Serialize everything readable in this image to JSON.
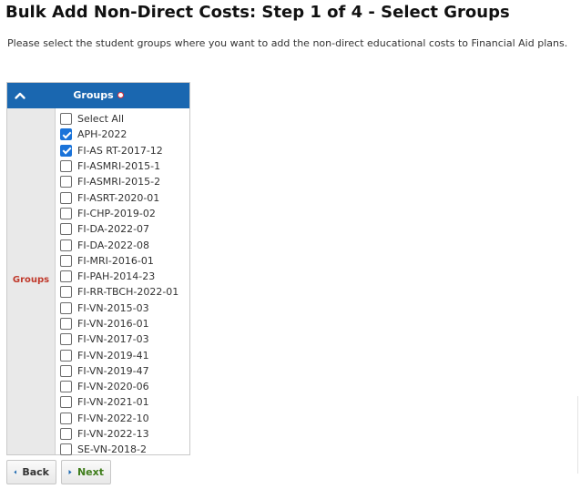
{
  "page": {
    "title": "Bulk Add Non-Direct Costs: Step 1 of 4 - Select Groups",
    "instructions": "Please select the student groups where you want to add the non-direct educational costs to Financial Aid plans."
  },
  "panel": {
    "title": "Groups",
    "row_label": "Groups",
    "options": [
      {
        "label": "Select All",
        "checked": false
      },
      {
        "label": "APH-2022",
        "checked": true
      },
      {
        "label": "FI-AS RT-2017-12",
        "checked": true
      },
      {
        "label": "FI-ASMRI-2015-1",
        "checked": false
      },
      {
        "label": "FI-ASMRI-2015-2",
        "checked": false
      },
      {
        "label": "FI-ASRT-2020-01",
        "checked": false
      },
      {
        "label": "FI-CHP-2019-02",
        "checked": false
      },
      {
        "label": "FI-DA-2022-07",
        "checked": false
      },
      {
        "label": "FI-DA-2022-08",
        "checked": false
      },
      {
        "label": "FI-MRI-2016-01",
        "checked": false
      },
      {
        "label": "FI-PAH-2014-23",
        "checked": false
      },
      {
        "label": "FI-RR-TBCH-2022-01",
        "checked": false
      },
      {
        "label": "FI-VN-2015-03",
        "checked": false
      },
      {
        "label": "FI-VN-2016-01",
        "checked": false
      },
      {
        "label": "FI-VN-2017-03",
        "checked": false
      },
      {
        "label": "FI-VN-2019-41",
        "checked": false
      },
      {
        "label": "FI-VN-2019-47",
        "checked": false
      },
      {
        "label": "FI-VN-2020-06",
        "checked": false
      },
      {
        "label": "FI-VN-2021-01",
        "checked": false
      },
      {
        "label": "FI-VN-2022-10",
        "checked": false
      },
      {
        "label": "FI-VN-2022-13",
        "checked": false
      },
      {
        "label": "SE-VN-2018-2",
        "checked": false
      }
    ]
  },
  "buttons": {
    "back_label": "Back",
    "next_label": "Next"
  },
  "colors": {
    "header_blue": "#1a67b0",
    "required_red": "#e0303a",
    "row_label_red": "#c0392b",
    "checkbox_blue": "#1a73d9",
    "next_green": "#3f7d1b"
  }
}
